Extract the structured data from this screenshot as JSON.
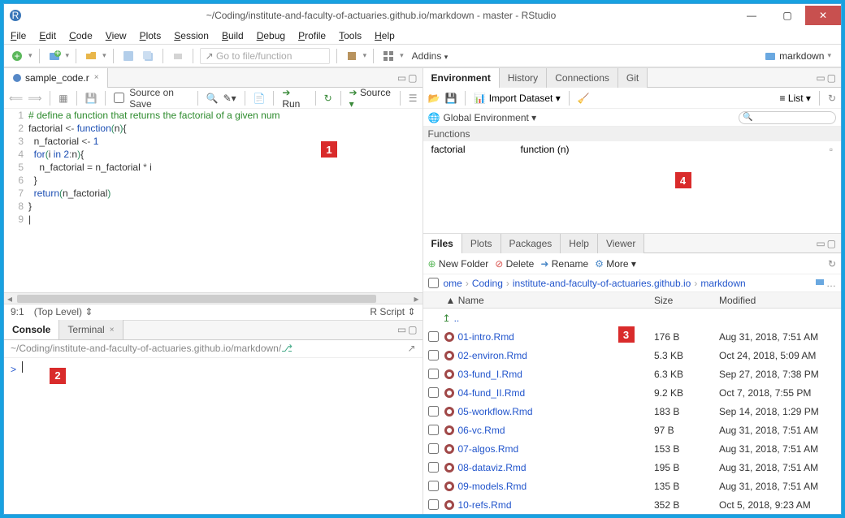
{
  "window": {
    "title": "~/Coding/institute-and-faculty-of-actuaries.github.io/markdown - master - RStudio"
  },
  "menubar": [
    "File",
    "Edit",
    "Code",
    "View",
    "Plots",
    "Session",
    "Build",
    "Debug",
    "Profile",
    "Tools",
    "Help"
  ],
  "toolbar": {
    "goto_placeholder": "Go to file/function",
    "addins": "Addins",
    "project": "markdown"
  },
  "source": {
    "tab_label": "sample_code.r",
    "source_on_save": "Source on Save",
    "run_label": "Run",
    "source_label": "Source",
    "lines": [
      "# define a function that returns the factorial of a given num",
      "factorial <- function(n){",
      "  n_factorial <- 1",
      "  for(i in 2:n){",
      "    n_factorial = n_factorial * i",
      "  }",
      "  return(n_factorial)",
      "}",
      ""
    ],
    "cursor_pos": "9:1",
    "scope": "(Top Level)",
    "lang": "R Script"
  },
  "console": {
    "tab_console": "Console",
    "tab_terminal": "Terminal",
    "path": "~/Coding/institute-and-faculty-of-actuaries.github.io/markdown/",
    "prompt": ">"
  },
  "env": {
    "tab_environment": "Environment",
    "tab_history": "History",
    "tab_connections": "Connections",
    "tab_git": "Git",
    "import": "Import Dataset",
    "list_mode": "List",
    "scope": "Global Environment",
    "section": "Functions",
    "items": [
      {
        "name": "factorial",
        "value": "function (n)"
      }
    ]
  },
  "files": {
    "tab_files": "Files",
    "tab_plots": "Plots",
    "tab_packages": "Packages",
    "tab_help": "Help",
    "tab_viewer": "Viewer",
    "new_folder": "New Folder",
    "delete": "Delete",
    "rename": "Rename",
    "more": "More",
    "breadcrumb": [
      "ome",
      "Coding",
      "institute-and-faculty-of-actuaries.github.io",
      "markdown"
    ],
    "col_name": "Name",
    "col_size": "Size",
    "col_mod": "Modified",
    "updir": "..",
    "rows": [
      {
        "name": "01-intro.Rmd",
        "size": "176 B",
        "mod": "Aug 31, 2018, 7:51 AM"
      },
      {
        "name": "02-environ.Rmd",
        "size": "5.3 KB",
        "mod": "Oct 24, 2018, 5:09 AM"
      },
      {
        "name": "03-fund_I.Rmd",
        "size": "6.3 KB",
        "mod": "Sep 27, 2018, 7:38 PM"
      },
      {
        "name": "04-fund_II.Rmd",
        "size": "9.2 KB",
        "mod": "Oct 7, 2018, 7:55 PM"
      },
      {
        "name": "05-workflow.Rmd",
        "size": "183 B",
        "mod": "Sep 14, 2018, 1:29 PM"
      },
      {
        "name": "06-vc.Rmd",
        "size": "97 B",
        "mod": "Aug 31, 2018, 7:51 AM"
      },
      {
        "name": "07-algos.Rmd",
        "size": "153 B",
        "mod": "Aug 31, 2018, 7:51 AM"
      },
      {
        "name": "08-dataviz.Rmd",
        "size": "195 B",
        "mod": "Aug 31, 2018, 7:51 AM"
      },
      {
        "name": "09-models.Rmd",
        "size": "135 B",
        "mod": "Aug 31, 2018, 7:51 AM"
      },
      {
        "name": "10-refs.Rmd",
        "size": "352 B",
        "mod": "Oct 5, 2018, 9:23 AM"
      }
    ]
  },
  "badges": {
    "1": "1",
    "2": "2",
    "3": "3",
    "4": "4"
  }
}
